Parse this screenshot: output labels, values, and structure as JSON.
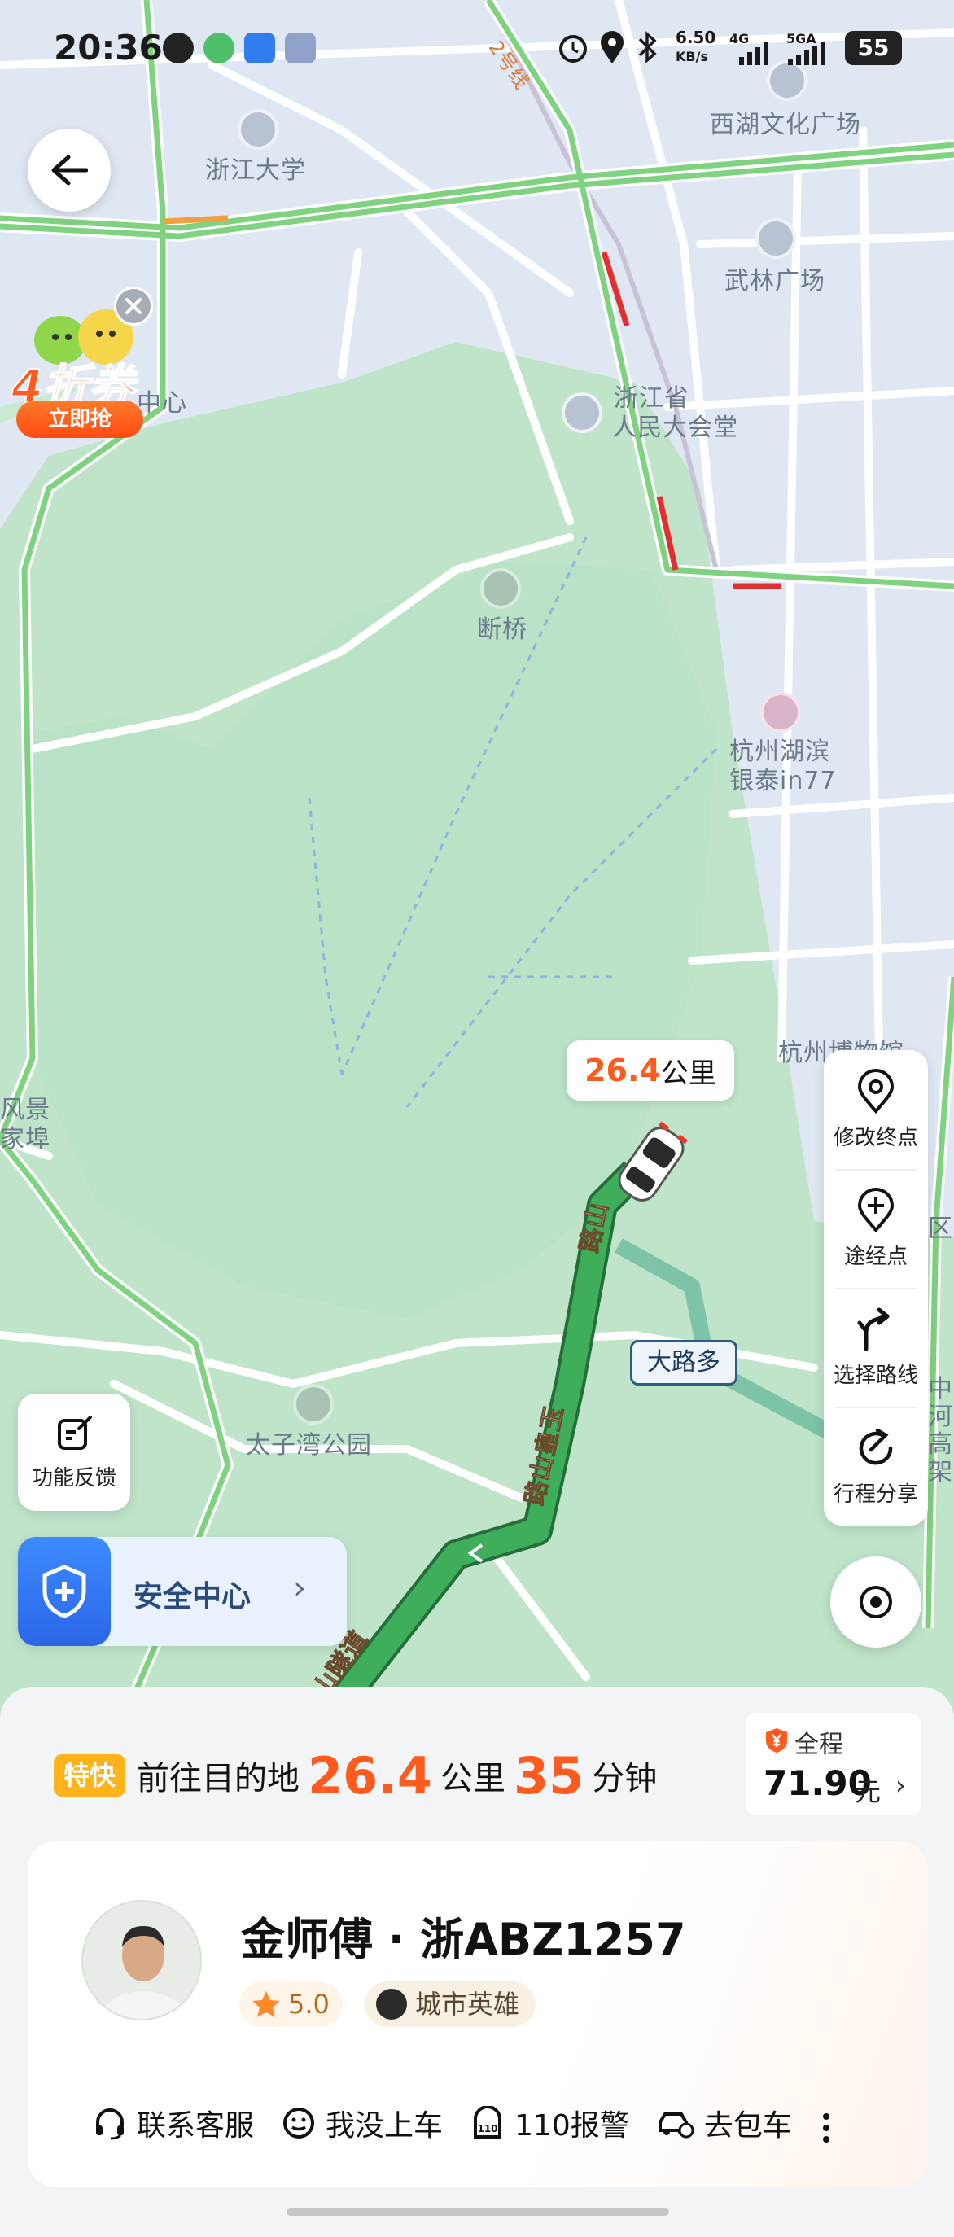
{
  "status_bar": {
    "time": "20:36",
    "net_speed": "6.50",
    "net_unit": "KB/s",
    "sig1": "4G",
    "sig2": "5GA",
    "battery": "55"
  },
  "map": {
    "labels": {
      "zju": "浙江大学",
      "xihu_culture": "西湖文化广场",
      "wulin": "武林广场",
      "congress_1": "浙江省",
      "congress_2": "人民大会堂",
      "center": "中心",
      "duanqiao": "断桥",
      "hubin_1": "杭州湖滨",
      "hubin_2": "银泰in77",
      "museum": "杭州博物馆",
      "taiziwan": "太子湾公园",
      "fengjing_1": "风景",
      "fengjing_2": "家埠",
      "line2": "2号线",
      "right_edge": "区",
      "right_vert": "中河高架"
    },
    "road_label_1": "路山皇玉",
    "road_label_2": "路山隧道",
    "road_label_3": "路山"
  },
  "coupon": {
    "title": "4折券",
    "button": "立即抢"
  },
  "distance_bubble": {
    "value": "26.4",
    "unit": "公里"
  },
  "road_tag": "大路多",
  "actions_panel": [
    {
      "label": "修改终点",
      "icon": "location-pin-icon"
    },
    {
      "label": "途经点",
      "icon": "add-waypoint-icon"
    },
    {
      "label": "选择路线",
      "icon": "route-branch-icon"
    },
    {
      "label": "行程分享",
      "icon": "share-trip-icon"
    }
  ],
  "feedback": {
    "label": "功能反馈"
  },
  "safety": {
    "label": "安全中心",
    "arrow": "›"
  },
  "trip": {
    "badge": "特快",
    "prefix": "前往目的地",
    "distance": "26.4",
    "distance_unit": "公里",
    "minutes": "35",
    "minutes_unit": "分钟"
  },
  "fare": {
    "label": "全程",
    "amount": "71.90",
    "unit": "元",
    "arrow": "›"
  },
  "driver": {
    "name": "金师傅 · 浙ABZ1257",
    "rating": "5.0",
    "honor": "城市英雄"
  },
  "driver_actions": [
    {
      "label": "联系客服",
      "icon": "headset-icon"
    },
    {
      "label": "我没上车",
      "icon": "face-icon"
    },
    {
      "label": "110报警",
      "icon": "police-110-icon"
    },
    {
      "label": "去包车",
      "icon": "charter-car-icon"
    }
  ],
  "colors": {
    "accent": "#ff5b1f",
    "route": "#3aa65a",
    "road_green": "#7fd27f",
    "badge": "#ffb21a"
  }
}
